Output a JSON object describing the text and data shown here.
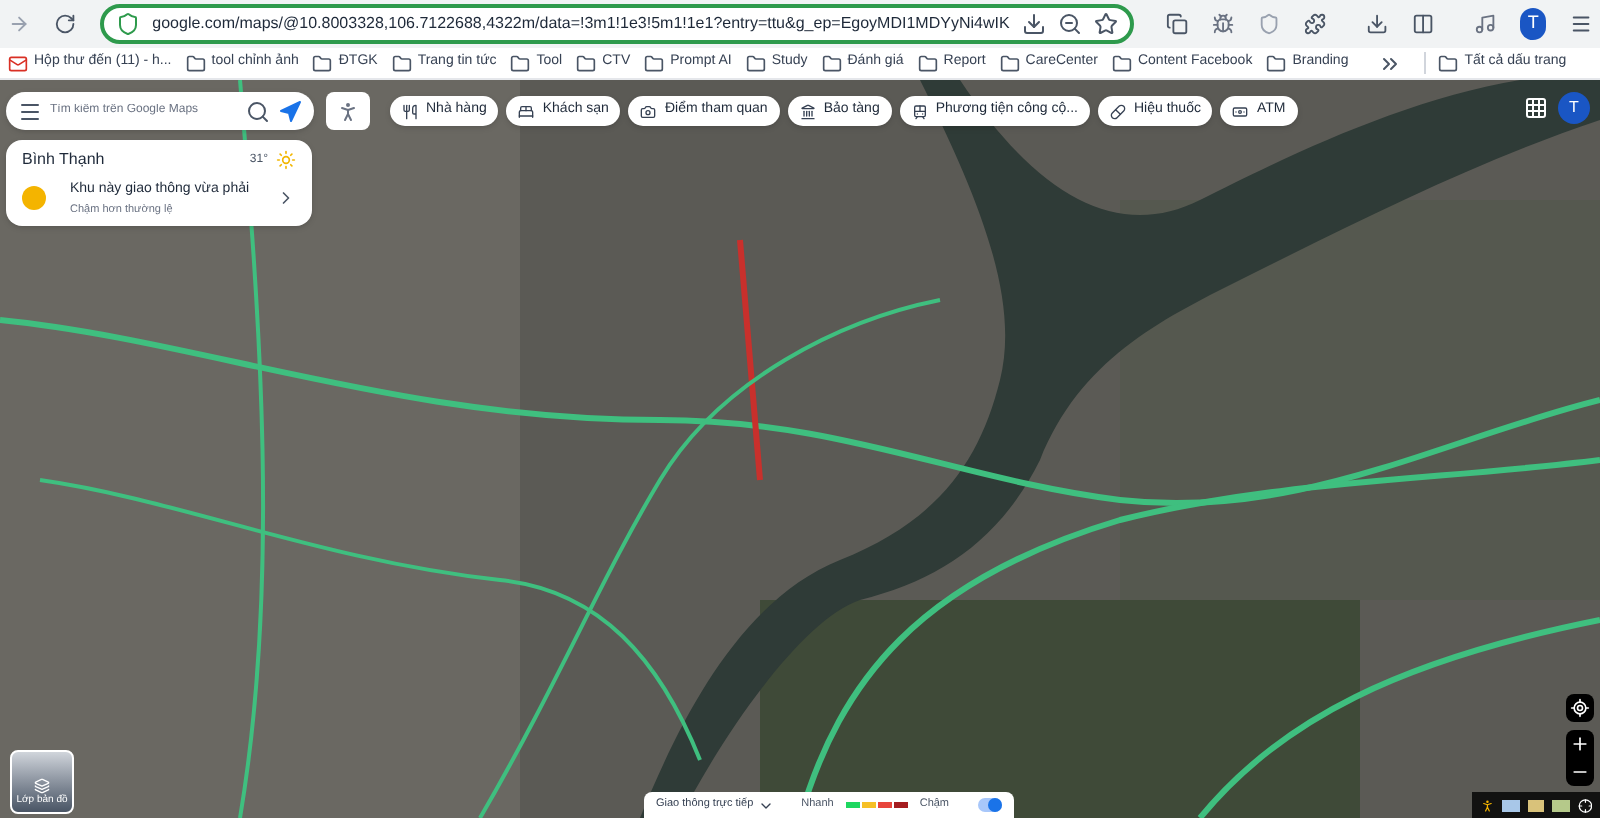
{
  "browser": {
    "url": "google.com/maps/@10.8003328,106.7122688,4322m/data=!3m1!1e3!5m1!1e1?entry=ttu&g_ep=EgoyMDI1MDYyNi4wIK",
    "profile_initial": "T"
  },
  "bookmarks": [
    {
      "label": "Hộp thư đến (11) - h...",
      "kind": "mail"
    },
    {
      "label": "tool chỉnh ảnh",
      "kind": "folder"
    },
    {
      "label": "ĐTGK",
      "kind": "folder"
    },
    {
      "label": "Trang tin tức",
      "kind": "folder"
    },
    {
      "label": "Tool",
      "kind": "folder"
    },
    {
      "label": "CTV",
      "kind": "folder"
    },
    {
      "label": "Prompt AI",
      "kind": "folder"
    },
    {
      "label": "Study",
      "kind": "folder"
    },
    {
      "label": "Đánh giá",
      "kind": "folder"
    },
    {
      "label": "Report",
      "kind": "folder"
    },
    {
      "label": "CareCenter",
      "kind": "folder"
    },
    {
      "label": "Content Facebook",
      "kind": "folder"
    },
    {
      "label": "Branding",
      "kind": "folder"
    }
  ],
  "all_bookmarks": "Tất cả dấu trang",
  "search": {
    "placeholder": "Tìm kiếm trên Google Maps"
  },
  "chips": [
    {
      "label": "Nhà hàng",
      "kind": "restaurant"
    },
    {
      "label": "Khách sạn",
      "kind": "hotel"
    },
    {
      "label": "Điểm tham quan",
      "kind": "attraction"
    },
    {
      "label": "Bảo tàng",
      "kind": "museum"
    },
    {
      "label": "Phương tiện công cộ...",
      "kind": "transit"
    },
    {
      "label": "Hiệu thuốc",
      "kind": "pharmacy"
    },
    {
      "label": "ATM",
      "kind": "atm"
    }
  ],
  "traffic_card": {
    "area": "Bình Thạnh",
    "temperature": "31°",
    "status": "Khu này giao thông vừa phải",
    "detail": "Chậm hơn thường lệ"
  },
  "layers": {
    "label": "Lớp bản đồ"
  },
  "legend": {
    "dropdown": "Giao thông trực tiếp",
    "fast": "Nhanh",
    "slow": "Chậm",
    "on": true
  },
  "map_profile_initial": "T"
}
